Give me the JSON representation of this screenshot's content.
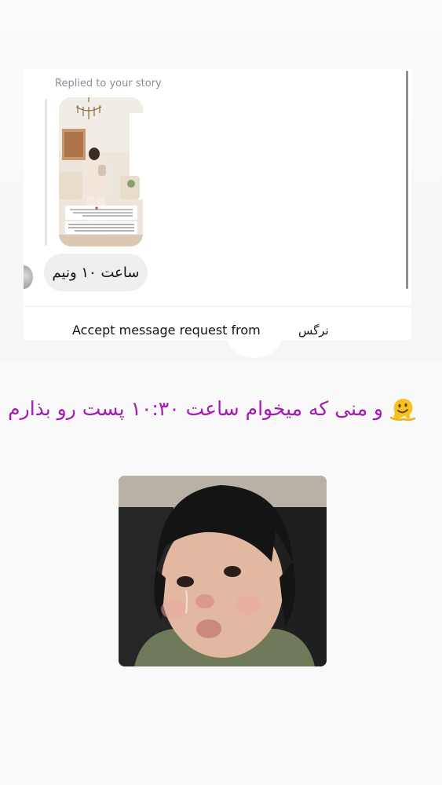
{
  "dm_card": {
    "replied_label": "Replied to your story",
    "message": "ساعت ۱۰ ونیم",
    "accept_text": "Accept message request from",
    "sender_name": "نرگس"
  },
  "caption": {
    "text": "و منی که میخوام ساعت ۱۰:۳۰ پست رو بذارم",
    "emoji": "melting-face-icon",
    "color": "#a31bb1"
  }
}
